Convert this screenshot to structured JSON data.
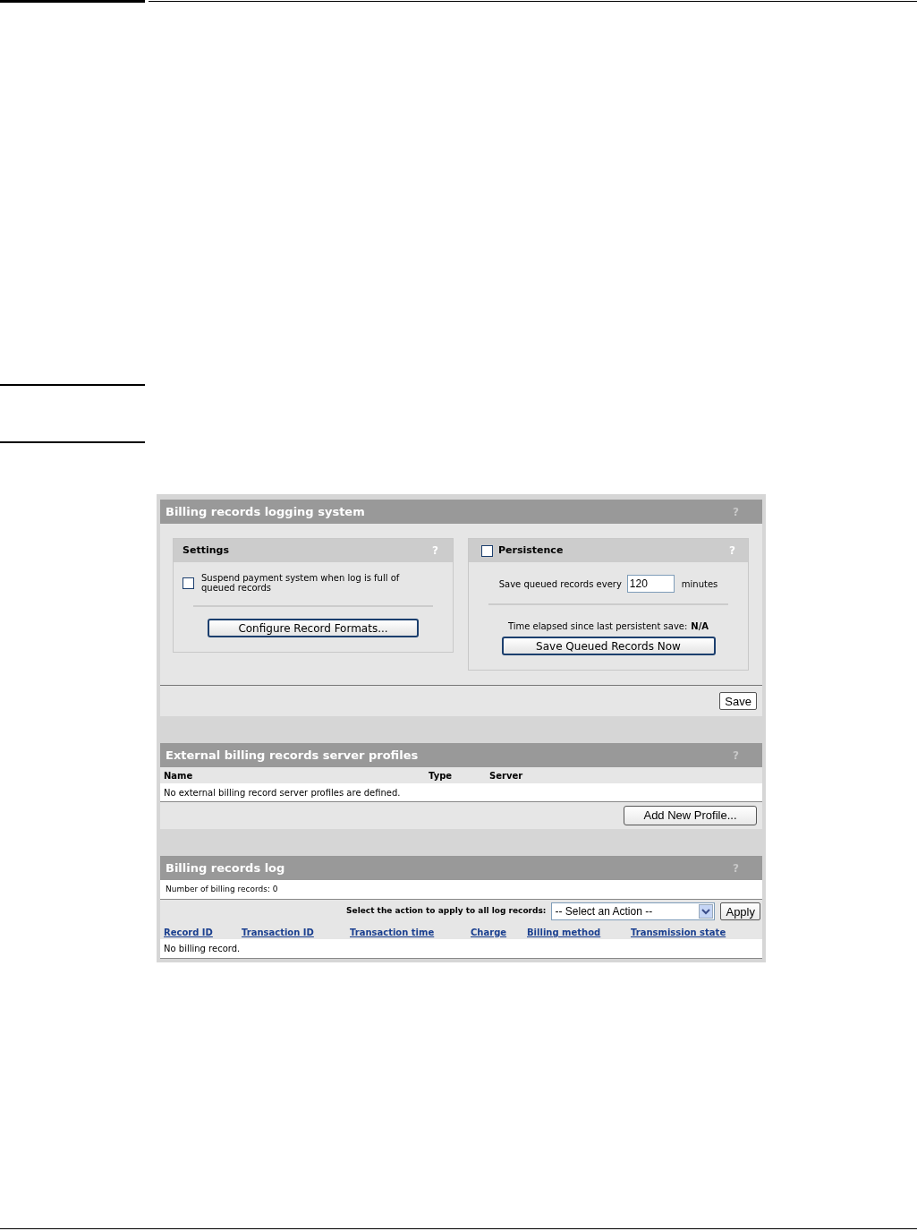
{
  "logging_system": {
    "title": "Billing records logging system",
    "help": "?",
    "settings": {
      "title": "Settings",
      "help": "?",
      "checkbox_label": "Suspend payment system when log is full of queued records",
      "checked": false,
      "button": "Configure Record Formats..."
    },
    "persistence": {
      "title": "Persistence",
      "help": "?",
      "checked": false,
      "interval_label": "Save queued records every",
      "interval_value": "120",
      "interval_unit": "minutes",
      "elapsed_label": "Time elapsed since last persistent save:",
      "elapsed_value": "N/A",
      "button": "Save Queued Records Now"
    },
    "save_button": "Save"
  },
  "server_profiles": {
    "title": "External billing records server profiles",
    "help": "?",
    "columns": [
      "Name",
      "Type",
      "Server"
    ],
    "empty_message": "No external billing record server profiles are defined.",
    "add_button": "Add New Profile..."
  },
  "records_log": {
    "title": "Billing records log",
    "help": "?",
    "count_label": "Number of billing records: 0",
    "action_label": "Select the action to apply to all log records:",
    "action_select": "-- Select an Action --",
    "apply_button": "Apply",
    "columns": [
      "Record ID",
      "Transaction ID",
      "Transaction time",
      "Charge",
      "Billing method",
      "Transmission state"
    ],
    "empty_message": "No billing record."
  }
}
